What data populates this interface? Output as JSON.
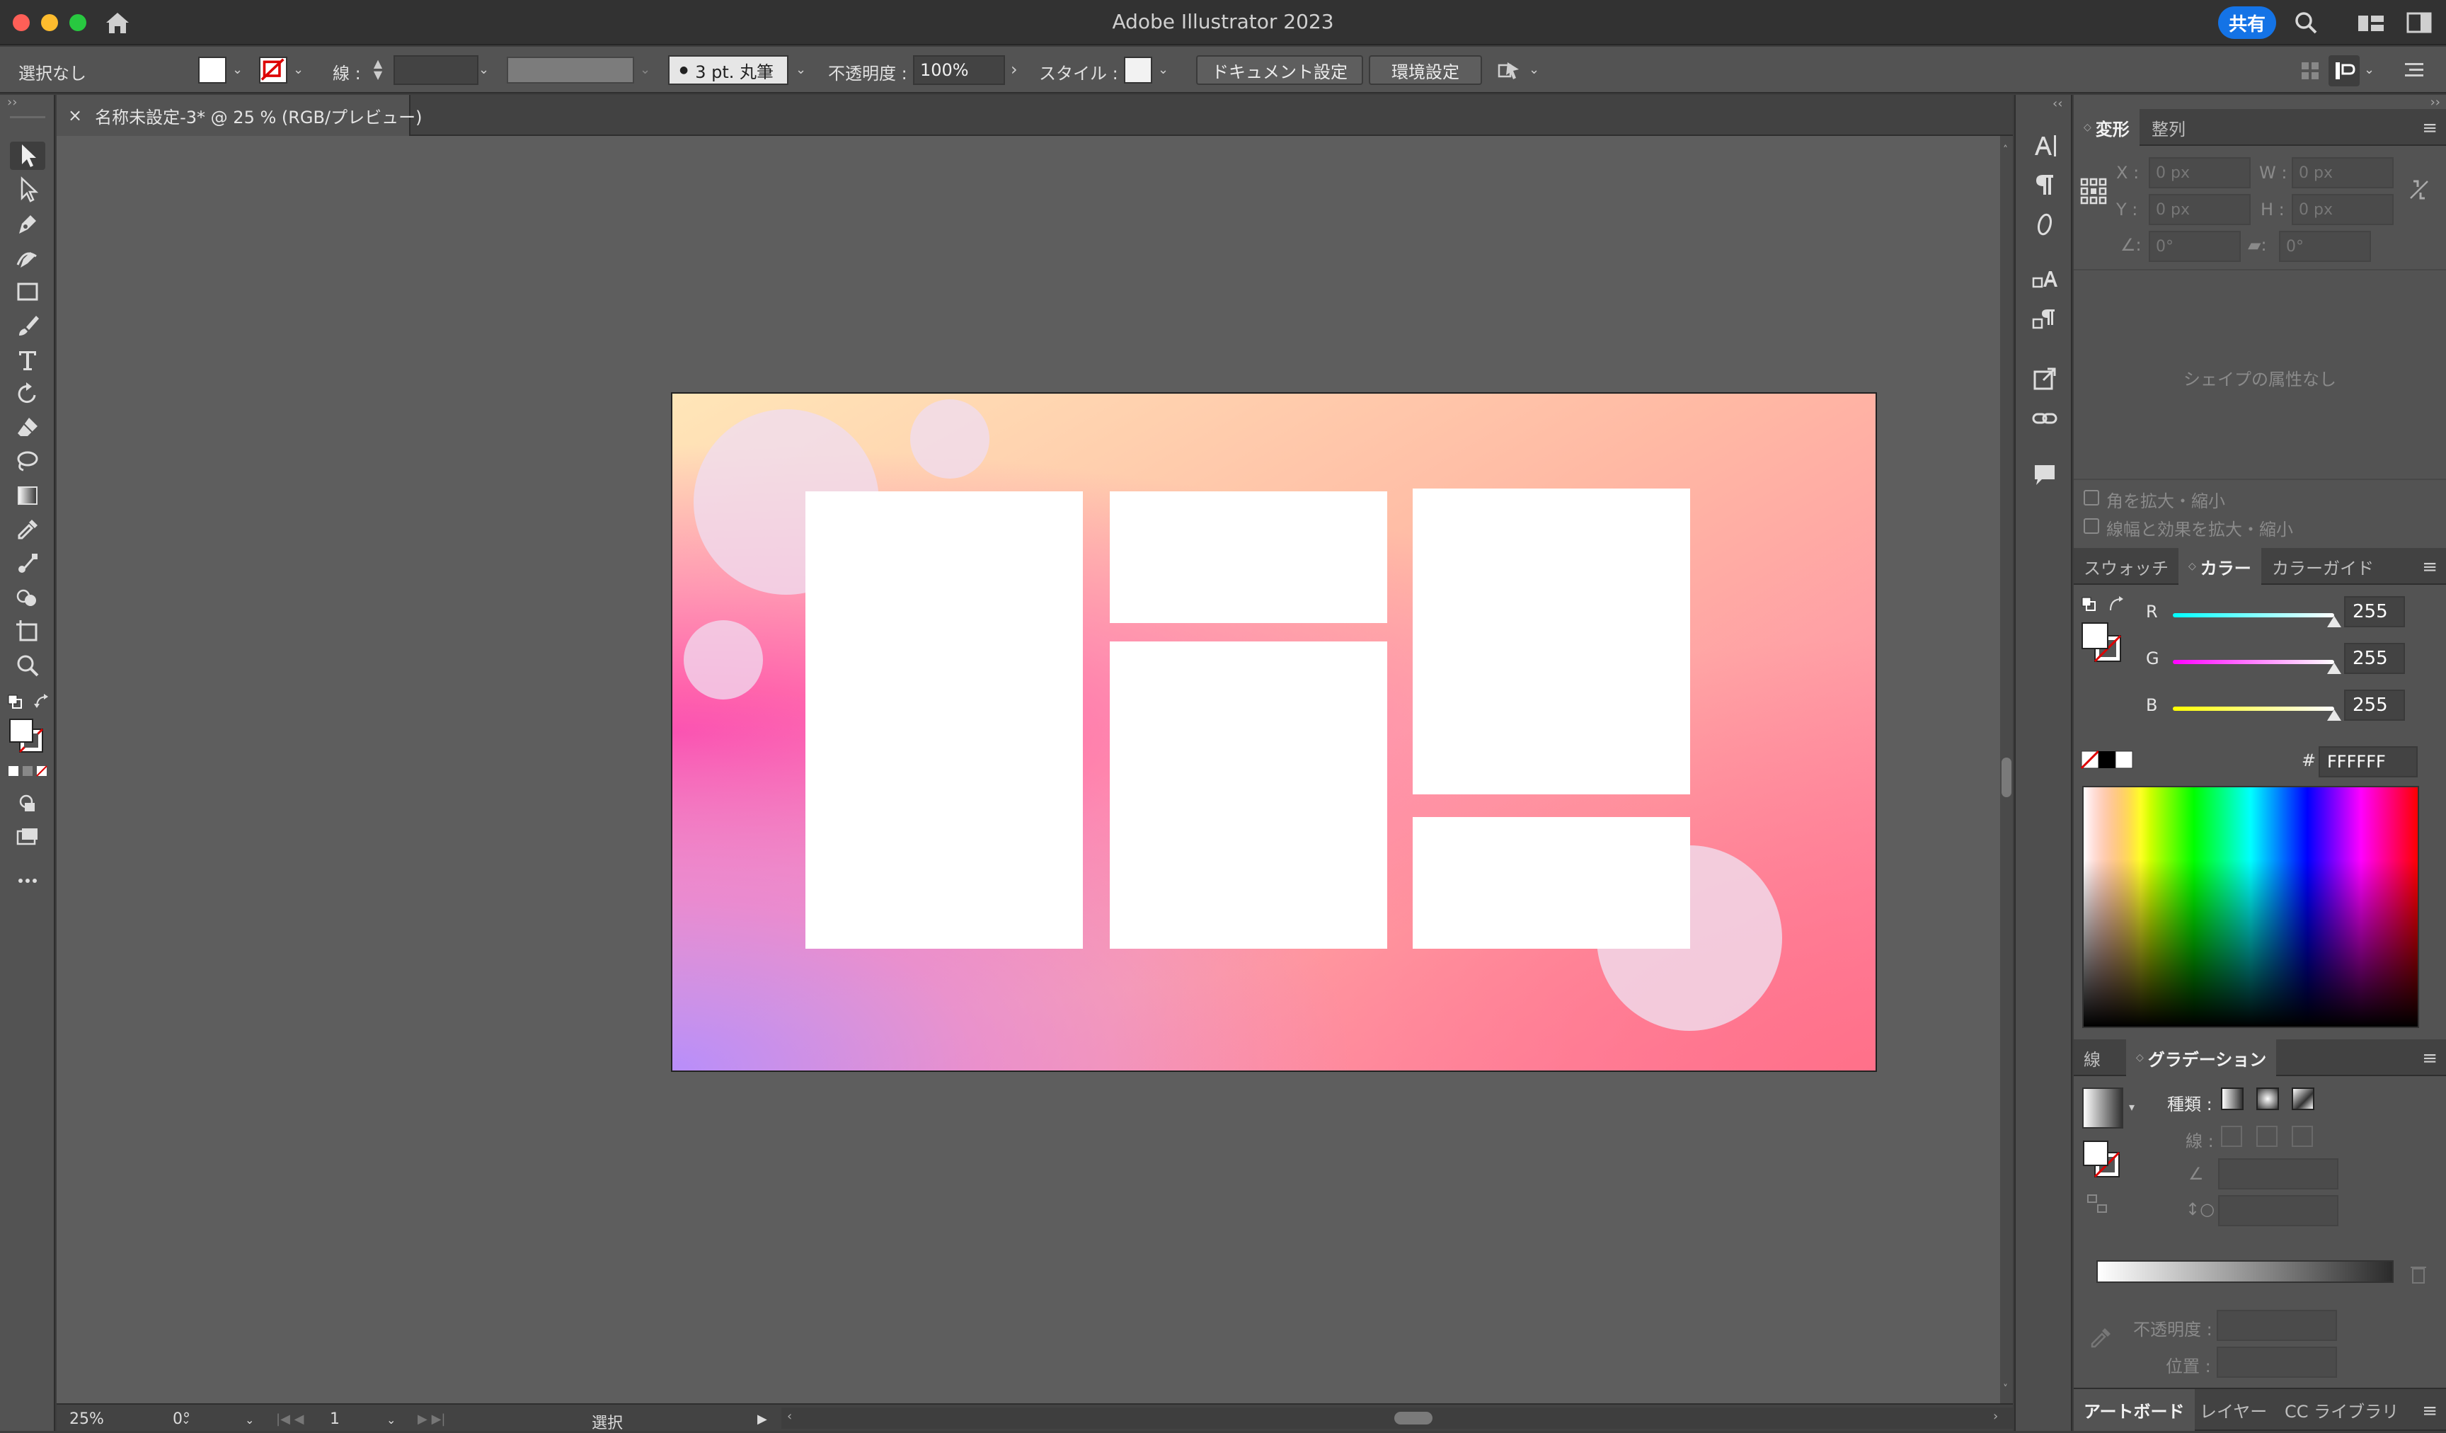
{
  "app": {
    "title": "Adobe Illustrator 2023",
    "share_label": "共有"
  },
  "control_bar": {
    "selection_status": "選択なし",
    "stroke_label": "線 :",
    "brush_label": "3 pt. 丸筆",
    "opacity_label": "不透明度 :",
    "opacity_value": "100%",
    "style_label": "スタイル :",
    "document_setup_label": "ドキュメント設定",
    "preferences_label": "環境設定"
  },
  "document": {
    "tab_label": "名称未設定-3* @ 25 % (RGB/プレビュー)",
    "close_glyph": "×"
  },
  "status_bar": {
    "zoom": "25%",
    "rotation": "0°",
    "artboard_number": "1",
    "mode": "選択"
  },
  "transform_panel": {
    "tabs": [
      "変形",
      "整列"
    ],
    "x_label": "X :",
    "y_label": "Y :",
    "w_label": "W :",
    "h_label": "H :",
    "x_value": "0 px",
    "y_value": "0 px",
    "w_value": "0 px",
    "h_value": "0 px",
    "angle_value": "0°",
    "shear_value": "0°",
    "no_shape_text": "シェイプの属性なし",
    "scale_corners_label": "角を拡大・縮小",
    "scale_strokes_label": "線幅と効果を拡大・縮小"
  },
  "color_panel": {
    "tabs": [
      "スウォッチ",
      "カラー",
      "カラーガイド"
    ],
    "r_label": "R",
    "g_label": "G",
    "b_label": "B",
    "r": "255",
    "g": "255",
    "b": "255",
    "r_level": 1.0,
    "g_level": 1.0,
    "b_level": 1.0,
    "hash_label": "#",
    "hex": "FFFFFF"
  },
  "gradient_panel": {
    "tabs": [
      "線",
      "グラデーション"
    ],
    "type_label": "種類 :",
    "stroke_label": "線 :",
    "opacity_label": "不透明度 :",
    "position_label": "位置 :"
  },
  "bottom_tabs": [
    "アートボード",
    "レイヤー",
    "CC ライブラリ"
  ],
  "colors": {
    "accent": "#1473e6",
    "artboard_gradient": [
      "#ff5aa8",
      "#ffa8a0",
      "#ffe6b8"
    ],
    "panel_bg": "#535353",
    "canvas_bg": "#5e5e5e"
  },
  "icons": [
    "home-icon",
    "search-icon",
    "workspace-icon",
    "arrange-icon",
    "selection-tool-icon",
    "direct-selection-tool-icon",
    "pen-tool-icon",
    "curvature-tool-icon",
    "rectangle-tool-icon",
    "paintbrush-tool-icon",
    "type-tool-icon",
    "rotate-tool-icon",
    "eraser-tool-icon",
    "lasso-tool-icon",
    "gradient-tool-icon",
    "eyedropper-tool-icon",
    "blend-tool-icon",
    "shape-builder-tool-icon",
    "artboard-tool-icon",
    "zoom-tool-icon",
    "more-tools-icon"
  ]
}
